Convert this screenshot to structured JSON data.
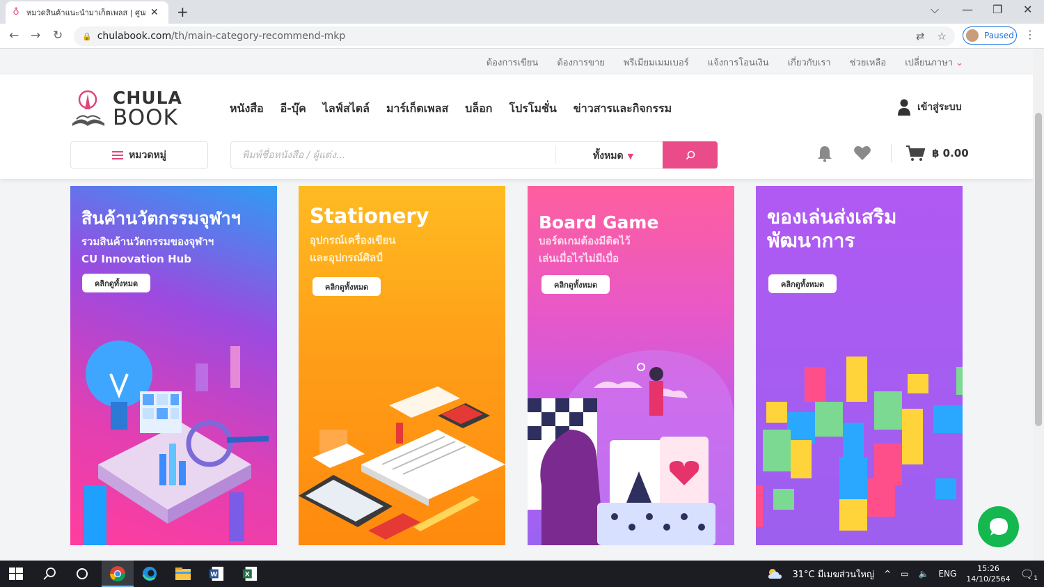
{
  "browser": {
    "tab_title": "หมวดสินค้าแนะนำมาเก็ตเพลส | ศูนย์หนังสือจุฬาฯ",
    "url_host": "chulabook.com",
    "url_path": "/th/main-category-recommend-mkp",
    "profile_label": "Paused"
  },
  "utility_links": [
    "ต้องการเขียน",
    "ต้องการขาย",
    "พรีเมียมเมมเบอร์",
    "แจ้งการโอนเงิน",
    "เกี่ยวกับเรา",
    "ช่วยเหลือ",
    "เปลี่ยนภาษา"
  ],
  "logo": {
    "line1": "CHULA",
    "line2": "BOOK"
  },
  "main_nav": [
    "หนังสือ",
    "อี-บุ๊ค",
    "ไลฟ์สไตล์",
    "มาร์เก็ตเพลส",
    "บล็อก",
    "โปรโมชั่น",
    "ข่าวสารและกิจกรรม"
  ],
  "login_label": "เข้าสู่ระบบ",
  "category_button": "หมวดหมู่",
  "search": {
    "placeholder": "พิมพ์ชื่อหนังสือ / ผู้แต่ง...",
    "scope": "ทั้งหมด"
  },
  "cart_total": "฿ 0.00",
  "cards": [
    {
      "title": "สินค้านวัตกรรมจุฬาฯ",
      "sub1": "รวมสินค้านวัตกรรมของจุฬาฯ",
      "sub2": "CU Innovation Hub",
      "button": "คลิกดูทั้งหมด"
    },
    {
      "title": "Stationery",
      "sub1": "อุปกรณ์เครื่องเขียน",
      "sub2": "และอุปกรณ์ศิลป์",
      "button": "คลิกดูทั้งหมด"
    },
    {
      "title": "Board Game",
      "sub1": "บอร์ดเกมต้องมีติดไว้",
      "sub2": "เล่นเมื่อไรไม่มีเบื่อ",
      "button": "คลิกดูทั้งหมด"
    },
    {
      "title": "ของเล่นส่งเสริม",
      "title2": "พัฒนาการ",
      "button": "คลิกดูทั้งหมด"
    }
  ],
  "taskbar": {
    "weather": "31°C มีเมฆส่วนใหญ่",
    "lang": "ENG",
    "time": "15:26",
    "date": "14/10/2564",
    "notif_count": "1"
  },
  "colors": {
    "accent": "#ea4c89",
    "chat": "#15b74f"
  }
}
